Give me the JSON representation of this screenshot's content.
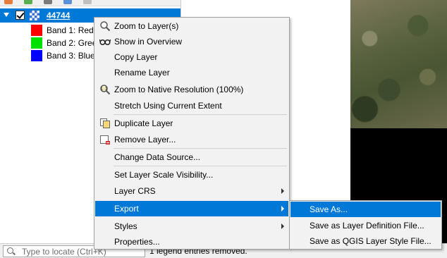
{
  "layers_panel": {
    "layer": {
      "name": "44744",
      "checked": true,
      "expanded": true
    },
    "bands": [
      {
        "label": "Band 1: Red (",
        "color": "#ff0000"
      },
      {
        "label": "Band 2: Gree",
        "color": "#00e000"
      },
      {
        "label": "Band 3: Blue",
        "color": "#0000ff"
      }
    ]
  },
  "locate_bar": {
    "placeholder": "Type to locate (Ctrl+K)"
  },
  "status": {
    "message": "1 legend entries removed."
  },
  "context_menu": {
    "items": [
      {
        "label": "Zoom to Layer(s)",
        "icon": "zoom-layer-icon"
      },
      {
        "label": "Show in Overview",
        "icon": "overview-glasses-icon"
      },
      {
        "label": "Copy Layer"
      },
      {
        "label": "Rename Layer"
      },
      {
        "label": "Zoom to Native Resolution (100%)",
        "icon": "zoom-native-icon"
      },
      {
        "label": "Stretch Using Current Extent"
      },
      {
        "label": "Duplicate Layer",
        "icon": "duplicate-icon"
      },
      {
        "label": "Remove Layer...",
        "icon": "remove-layer-icon"
      },
      {
        "label": "Change Data Source..."
      },
      {
        "label": "Set Layer Scale Visibility..."
      },
      {
        "label": "Layer CRS",
        "submenu": true
      },
      {
        "label": "Export",
        "submenu": true,
        "active": true
      },
      {
        "label": "Styles",
        "submenu": true
      },
      {
        "label": "Properties..."
      }
    ]
  },
  "export_submenu": {
    "items": [
      {
        "label": "Save As...",
        "active": true
      },
      {
        "label": "Save as Layer Definition File..."
      },
      {
        "label": "Save as QGIS Layer Style File..."
      }
    ]
  },
  "colors": {
    "highlight": "#0078d7",
    "menu_bg": "#f2f2f2"
  }
}
